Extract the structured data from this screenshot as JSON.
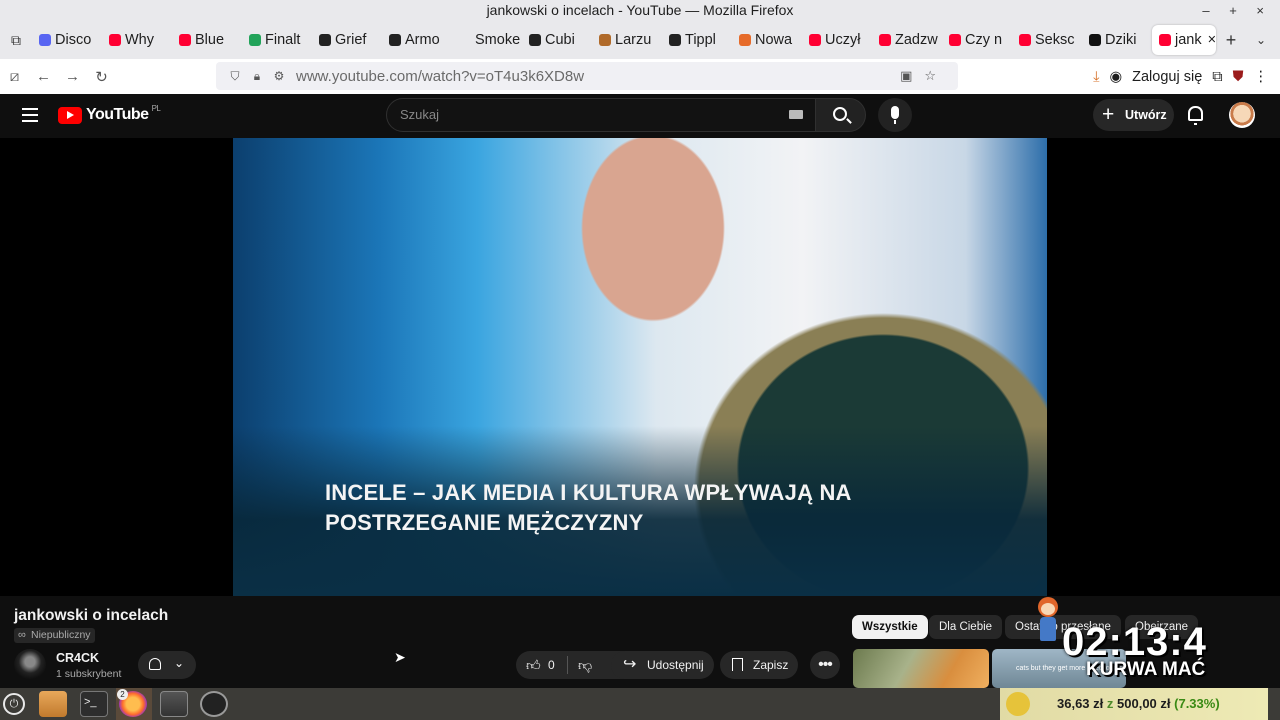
{
  "window": {
    "title": "jankowski o incelach - YouTube — Mozilla Firefox",
    "wm_buttons": "– + ×"
  },
  "tabs": [
    {
      "label": "Disco",
      "color": "#5865f2"
    },
    {
      "label": "Why",
      "color": "#ff0033"
    },
    {
      "label": "Blue",
      "color": "#ff0033"
    },
    {
      "label": "Finalt",
      "color": "#22a35a"
    },
    {
      "label": "Grief",
      "color": "#222222"
    },
    {
      "label": "Armo",
      "color": "#222222"
    },
    {
      "label": "Smoke",
      "color": "#e9e9ec"
    },
    {
      "label": "Cubi",
      "color": "#222222"
    },
    {
      "label": "Larzu",
      "color": "#b06a2a"
    },
    {
      "label": "Tippl",
      "color": "#222222"
    },
    {
      "label": "Nowa",
      "color": "#e66b2a"
    },
    {
      "label": "Uczył",
      "color": "#ff0033"
    },
    {
      "label": "Zadzw",
      "color": "#ff0033"
    },
    {
      "label": "Czy n",
      "color": "#ff0033"
    },
    {
      "label": "Seksc",
      "color": "#ff0033"
    },
    {
      "label": "Dziki",
      "color": "#111111"
    },
    {
      "label": "jank",
      "color": "#ff0033",
      "active": true
    }
  ],
  "toolbar": {
    "new_tab": "+",
    "tabs_menu": "⌄",
    "url": "www.youtube.com/watch?v=oT4u3k6XD8w",
    "login": "Zaloguj się"
  },
  "youtube": {
    "logo_text": "YouTube",
    "country": "PL",
    "search_placeholder": "Szukaj",
    "create_label": "Utwórz",
    "video_caption_line1": "INCELE – JAK MEDIA I KULTURA WPŁYWAJĄ NA",
    "video_caption_line2": "POSTRZEGANIE MĘŻCZYZNY",
    "video_title": "jankowski o incelach",
    "privacy": "Niepubliczny",
    "channel_name": "CR4CK",
    "subscribers": "1 subskrybent",
    "likes": "0",
    "share_label": "Udostępnij",
    "save_label": "Zapisz",
    "chips": [
      "Wszystkie",
      "Dla Ciebie",
      "Ostatnio przesłane",
      "Obejrzane"
    ],
    "thumb2_text": "cats but they get more affectionate"
  },
  "overlay": {
    "timer": "02:13:4",
    "text": "KURWA MAĆ"
  },
  "donation": {
    "current": "36,63 zł",
    "sep": "z",
    "goal": "500,00 zł",
    "percent": "(7.33%)"
  },
  "taskbar": {
    "firefox_badge": "2"
  }
}
